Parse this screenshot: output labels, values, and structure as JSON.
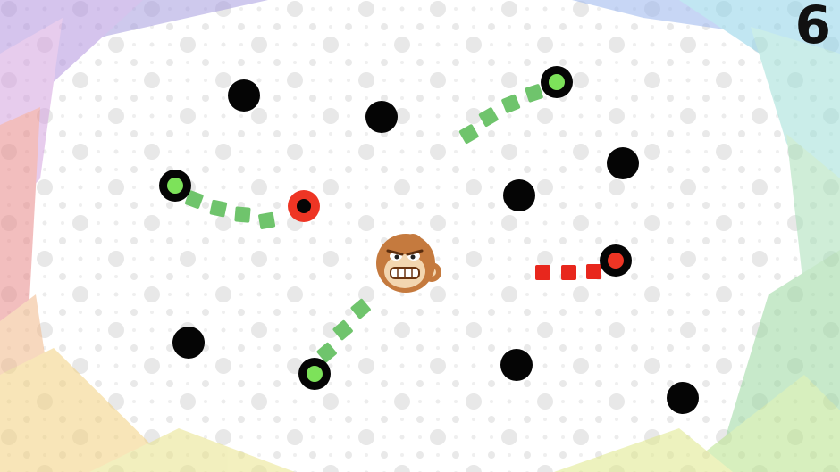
{
  "hud": {
    "score": "6"
  },
  "colors": {
    "background": "#ffffff",
    "dot_pattern": "#e6e6e6",
    "peg": "#050505",
    "active_node": "#7de25a",
    "danger_node": "#ee3524",
    "trail_green": "#6fc46c",
    "trail_red": "#e8271d",
    "monkey_fur": "#c57a3e",
    "monkey_face": "#f3d6b0",
    "frame_tints": [
      "#a79de0",
      "#e78e8e",
      "#f2d08a",
      "#9ad8b0",
      "#8fd3e8",
      "#b6a8e6",
      "#e9e08a",
      "#a8e0b8"
    ]
  },
  "icons": {
    "peg": "black-circle-icon",
    "green_node": "green-ring-icon",
    "red_node": "red-ring-icon",
    "player": "monkey-face-icon"
  }
}
